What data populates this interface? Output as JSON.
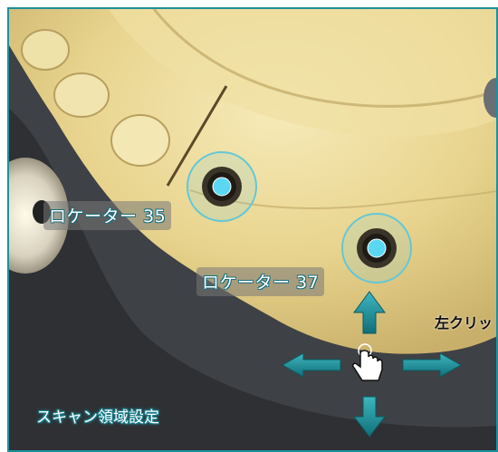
{
  "locators": [
    {
      "label": "ロケーター 35"
    },
    {
      "label": "ロケーター 37"
    }
  ],
  "hints": {
    "left_click": "左クリッ",
    "scan_area": "スキャン領域設定"
  },
  "icons": {
    "cursor": "hand-pointer-icon",
    "pan_arrows": [
      "arrow-up-icon",
      "arrow-down-icon",
      "arrow-left-icon",
      "arrow-right-icon"
    ]
  },
  "colors": {
    "frame": "#1f8f9c",
    "marker_fill": "#5ad8f2",
    "arrow": "#1d8c95",
    "model": "#e9d896"
  }
}
